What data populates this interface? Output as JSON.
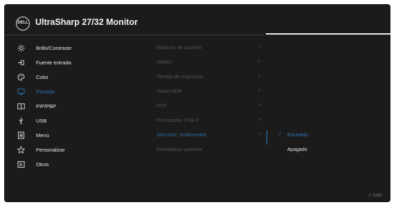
{
  "header": {
    "logo_text": "DELL",
    "title": "UltraSharp 27/32 Monitor"
  },
  "menu": {
    "items": [
      {
        "label": "Brillo/Contraste",
        "icon": "brightness-icon"
      },
      {
        "label": "Fuente entrada",
        "icon": "input-source-icon"
      },
      {
        "label": "Color",
        "icon": "color-palette-icon"
      },
      {
        "label": "Pantalla",
        "icon": "display-icon",
        "selected": true
      },
      {
        "label": "PIP/PBP",
        "icon": "pip-pbp-icon"
      },
      {
        "label": "USB",
        "icon": "usb-icon"
      },
      {
        "label": "Menú",
        "icon": "menu-icon"
      },
      {
        "label": "Personalizar",
        "icon": "star-icon"
      },
      {
        "label": "Otros",
        "icon": "others-icon"
      }
    ]
  },
  "submenu": {
    "items": [
      {
        "label": "Relación de aspecto",
        "chevron": ">"
      },
      {
        "label": "Nitidez",
        "chevron": ">"
      },
      {
        "label": "Tiempo de respuesta",
        "chevron": ">"
      },
      {
        "label": "Smart HDR",
        "chevron": ">"
      },
      {
        "label": "MST",
        "chevron": ">"
      },
      {
        "label": "Priorización USB-C",
        "chevron": ">"
      },
      {
        "label": "Sincroniz. multimonitor",
        "chevron": ">",
        "active": true
      },
      {
        "label": "Restablecer pantalla",
        "chevron": ""
      }
    ]
  },
  "options": {
    "items": [
      {
        "label": "Encedido",
        "check": "✓",
        "selected": true
      },
      {
        "label": "Apagado",
        "check": "",
        "selected": false
      }
    ]
  },
  "footer": {
    "exit_label": "<  Salir"
  },
  "colors": {
    "background": "#1b1b1b",
    "accent": "#2f78bd",
    "text": "#eaeaea",
    "dim_text": "#545454"
  }
}
